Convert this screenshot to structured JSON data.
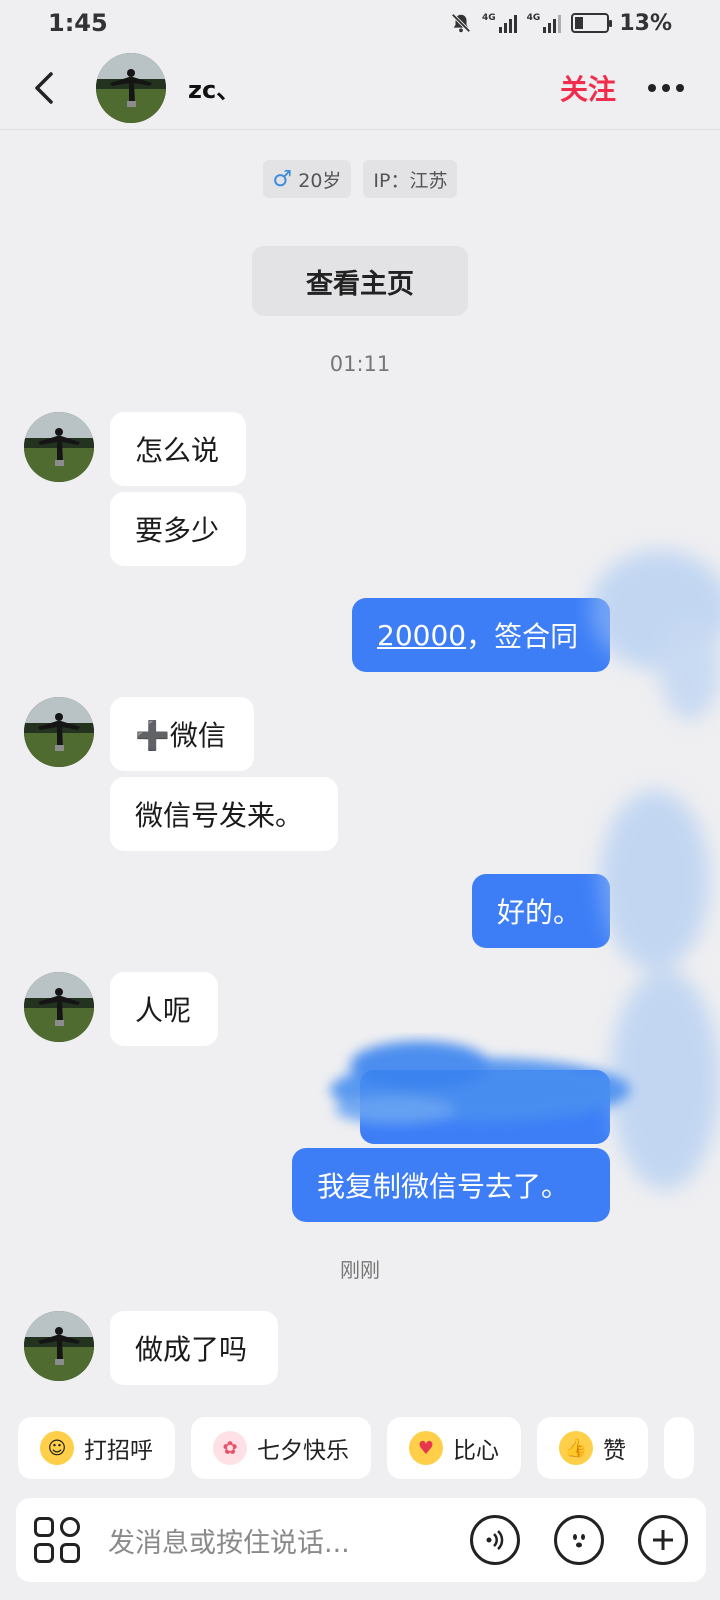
{
  "status": {
    "time": "1:45",
    "battery": "13%",
    "net1": "4G",
    "net2": "4G"
  },
  "header": {
    "name": "zc、",
    "follow_label": "关注"
  },
  "profile": {
    "gender_icon": "♂",
    "age": "20岁",
    "ip": "IP：江苏",
    "view_profile": "查看主页"
  },
  "timestamps": {
    "first": "01:11",
    "recent": "刚刚"
  },
  "messages": {
    "m1": "怎么说",
    "m2": "要多少",
    "m3_link": "20000",
    "m3_rest": "，签合同",
    "m4": "➕微信",
    "m5": "微信号发来。",
    "m6": "好的。",
    "m7": "人呢",
    "m8": "",
    "m9": "我复制微信号去了。",
    "m10": "做成了吗"
  },
  "quick_replies": [
    {
      "label": "打招呼",
      "icon": "smile-hug"
    },
    {
      "label": "七夕快乐",
      "icon": "bird"
    },
    {
      "label": "比心",
      "icon": "duck-heart"
    },
    {
      "label": "赞",
      "icon": "thumbs-up"
    }
  ],
  "input": {
    "placeholder": "发消息或按住说话..."
  },
  "colors": {
    "accent": "#3d7ef7",
    "follow": "#f02d4d",
    "background": "#efeff1"
  }
}
